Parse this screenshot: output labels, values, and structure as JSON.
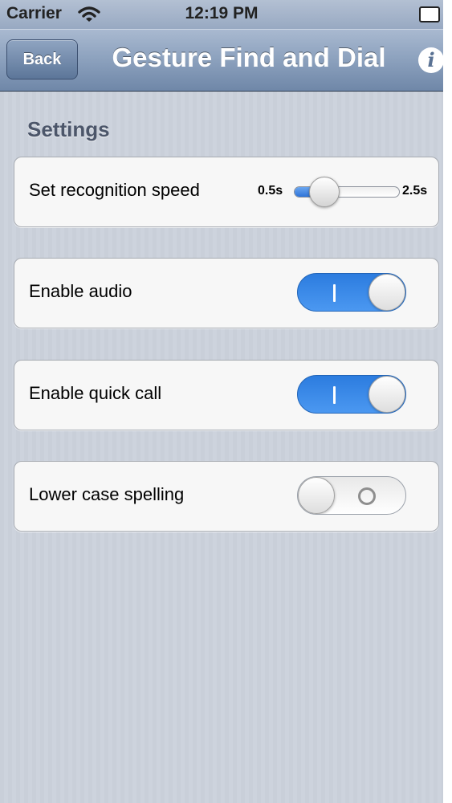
{
  "status_bar": {
    "carrier": "Carrier",
    "time": "12:19 PM",
    "icons": [
      "wifi-icon",
      "battery-icon"
    ]
  },
  "nav_bar": {
    "back_label": "Back",
    "title": "Gesture Find and Dial",
    "info_glyph": "i",
    "icons": [
      "info-icon"
    ]
  },
  "settings": {
    "header": "Settings",
    "recognition_speed": {
      "label": "Set recognition speed",
      "min_label": "0.5s",
      "max_label": "2.5s",
      "value_fraction": 0.2
    },
    "enable_audio": {
      "label": "Enable audio",
      "on": true
    },
    "enable_quick_call": {
      "label": "Enable quick call",
      "on": true
    },
    "lower_case_spelling": {
      "label": "Lower case spelling",
      "on": false
    }
  },
  "colors": {
    "accent_blue": "#2f7ee0",
    "nav_bar": "#7d93b3",
    "background": "#cbd1db"
  }
}
